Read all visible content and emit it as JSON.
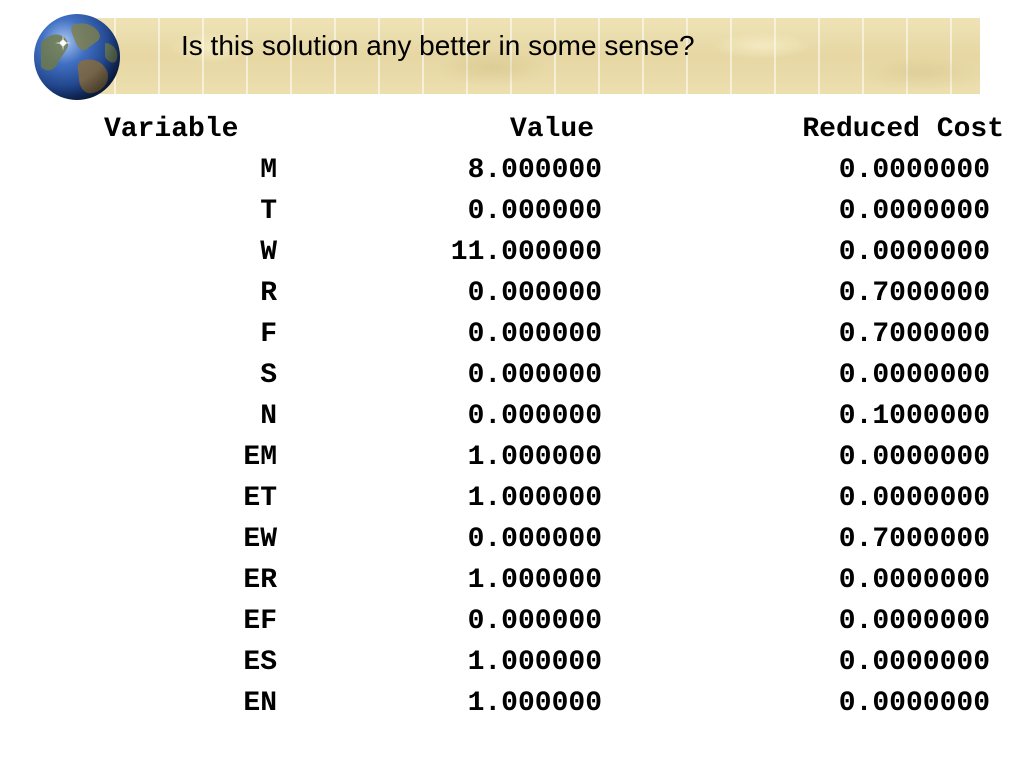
{
  "slide": {
    "title": "Is this solution any better in some sense?"
  },
  "table": {
    "headers": {
      "variable": "Variable",
      "value": "Value",
      "reduced_cost": "Reduced Cost"
    },
    "rows": [
      {
        "variable": "M",
        "value": "8.000000",
        "reduced_cost": "0.0000000"
      },
      {
        "variable": "T",
        "value": "0.000000",
        "reduced_cost": "0.0000000"
      },
      {
        "variable": "W",
        "value": "11.000000",
        "reduced_cost": "0.0000000"
      },
      {
        "variable": "R",
        "value": "0.000000",
        "reduced_cost": "0.7000000"
      },
      {
        "variable": "F",
        "value": "0.000000",
        "reduced_cost": "0.7000000"
      },
      {
        "variable": "S",
        "value": "0.000000",
        "reduced_cost": "0.0000000"
      },
      {
        "variable": "N",
        "value": "0.000000",
        "reduced_cost": "0.1000000"
      },
      {
        "variable": "EM",
        "value": "1.000000",
        "reduced_cost": "0.0000000"
      },
      {
        "variable": "ET",
        "value": "1.000000",
        "reduced_cost": "0.0000000"
      },
      {
        "variable": "EW",
        "value": "0.000000",
        "reduced_cost": "0.7000000"
      },
      {
        "variable": "ER",
        "value": "1.000000",
        "reduced_cost": "0.0000000"
      },
      {
        "variable": "EF",
        "value": "0.000000",
        "reduced_cost": "0.0000000"
      },
      {
        "variable": "ES",
        "value": "1.000000",
        "reduced_cost": "0.0000000"
      },
      {
        "variable": "EN",
        "value": "1.000000",
        "reduced_cost": "0.0000000"
      }
    ]
  }
}
